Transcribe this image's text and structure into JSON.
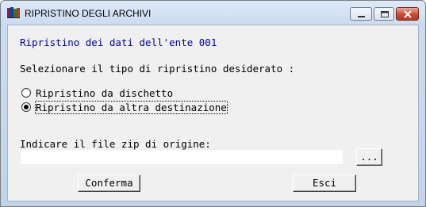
{
  "window": {
    "title": "RIPRISTINO DEGLI ARCHIVI",
    "title_icon": "archive-books-icon"
  },
  "main": {
    "header": "Ripristino dei dati dell'ente 001",
    "prompt": "Selezionare il tipo di ripristino desiderato :",
    "options": [
      {
        "label": "Ripristino da dischetto",
        "selected": false
      },
      {
        "label": "Ripristino da altra destinazione",
        "selected": true
      }
    ],
    "zip_label": "Indicare il file zip di origine:",
    "zip_value": "",
    "browse_label": "...",
    "confirm_label": "Conferma",
    "exit_label": "Esci"
  },
  "colors": {
    "header_text": "#0000aa",
    "client_bg": "#f0f0f0"
  }
}
